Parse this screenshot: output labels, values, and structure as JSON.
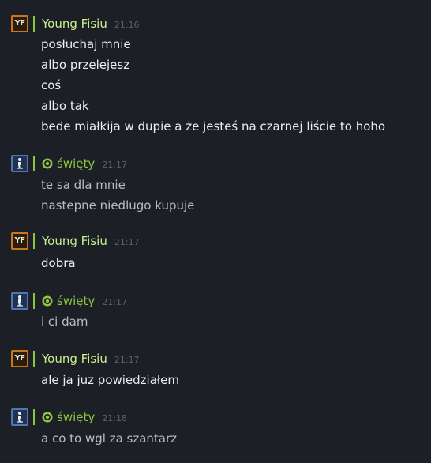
{
  "messages": [
    {
      "author": "Young Fisiu",
      "avatar_text": "YF",
      "time": "21:16",
      "lines": [
        "posłuchaj mnie",
        "albo przelejesz",
        "coś",
        "albo tak",
        "bede miałkija w dupie a że jesteś na czarnej liście to hoho"
      ]
    },
    {
      "author": "święty",
      "time": "21:17",
      "lines": [
        "te sa dla mnie",
        "nastepne niedlugo kupuje"
      ]
    },
    {
      "author": "Young Fisiu",
      "avatar_text": "YF",
      "time": "21:17",
      "lines": [
        "dobra"
      ]
    },
    {
      "author": "święty",
      "time": "21:17",
      "lines": [
        "i ci dam"
      ]
    },
    {
      "author": "Young Fisiu",
      "avatar_text": "YF",
      "time": "21:17",
      "lines": [
        "ale ja juz powiedziałem"
      ]
    },
    {
      "author": "święty",
      "time": "21:18",
      "lines": [
        "a co to wgl za szantarz"
      ]
    }
  ],
  "colors": {
    "background": "#1c1f26",
    "in_game_green": "#8cc63f",
    "name_light_green": "#c8ef8e",
    "timestamp": "#5b616b"
  },
  "icons": {
    "status": "steam-level-badge-icon",
    "avatar_sw": "wheelchair-figure-icon"
  }
}
